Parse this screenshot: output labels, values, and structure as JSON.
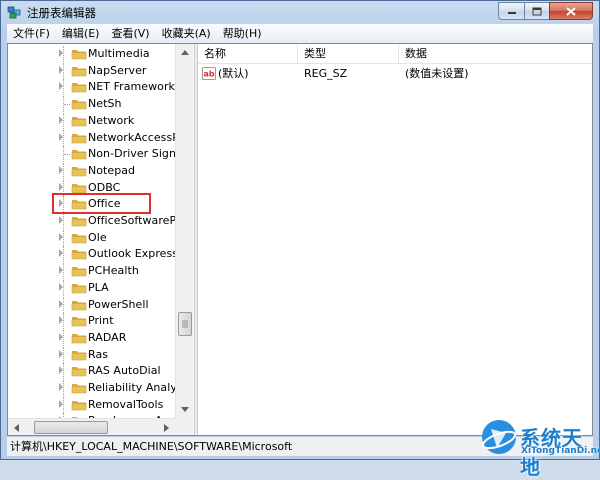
{
  "window": {
    "title": "注册表编辑器",
    "controls": {
      "minimize_icon": "minimize-icon",
      "maximize_icon": "maximize-icon",
      "close_icon": "close-icon"
    }
  },
  "menubar": {
    "items": [
      "文件(F)",
      "编辑(E)",
      "查看(V)",
      "收藏夹(A)",
      "帮助(H)"
    ]
  },
  "tree": {
    "items": [
      {
        "label": "Multimedia",
        "expandable": true
      },
      {
        "label": "NapServer",
        "expandable": true
      },
      {
        "label": "NET Framework S",
        "expandable": true
      },
      {
        "label": "NetSh",
        "expandable": false
      },
      {
        "label": "Network",
        "expandable": true
      },
      {
        "label": "NetworkAccessPro",
        "expandable": true
      },
      {
        "label": "Non-Driver Signin",
        "expandable": false
      },
      {
        "label": "Notepad",
        "expandable": true
      },
      {
        "label": "ODBC",
        "expandable": true
      },
      {
        "label": "Office",
        "expandable": true,
        "highlighted": true
      },
      {
        "label": "OfficeSoftwarePro",
        "expandable": true
      },
      {
        "label": "Ole",
        "expandable": true
      },
      {
        "label": "Outlook Express",
        "expandable": true
      },
      {
        "label": "PCHealth",
        "expandable": true
      },
      {
        "label": "PLA",
        "expandable": true
      },
      {
        "label": "PowerShell",
        "expandable": true
      },
      {
        "label": "Print",
        "expandable": true
      },
      {
        "label": "RADAR",
        "expandable": true
      },
      {
        "label": "Ras",
        "expandable": true
      },
      {
        "label": "RAS AutoDial",
        "expandable": true
      },
      {
        "label": "Reliability Analysis",
        "expandable": true
      },
      {
        "label": "RemovalTools",
        "expandable": true
      },
      {
        "label": "RendezvousApps",
        "expandable": true
      }
    ]
  },
  "list": {
    "columns": [
      "名称",
      "类型",
      "数据"
    ],
    "rows": [
      {
        "name": "(默认)",
        "type": "REG_SZ",
        "data": "(数值未设置)",
        "icon": "string-value-icon"
      }
    ]
  },
  "statusbar": {
    "path": "计算机\\HKEY_LOCAL_MACHINE\\SOFTWARE\\Microsoft"
  },
  "watermark": {
    "cn": "系统天地",
    "en": "XiTongTianDi.net"
  },
  "colors": {
    "highlight_box": "#e0302e",
    "watermark": "#1b7fd0",
    "folder": "#e8c258"
  }
}
